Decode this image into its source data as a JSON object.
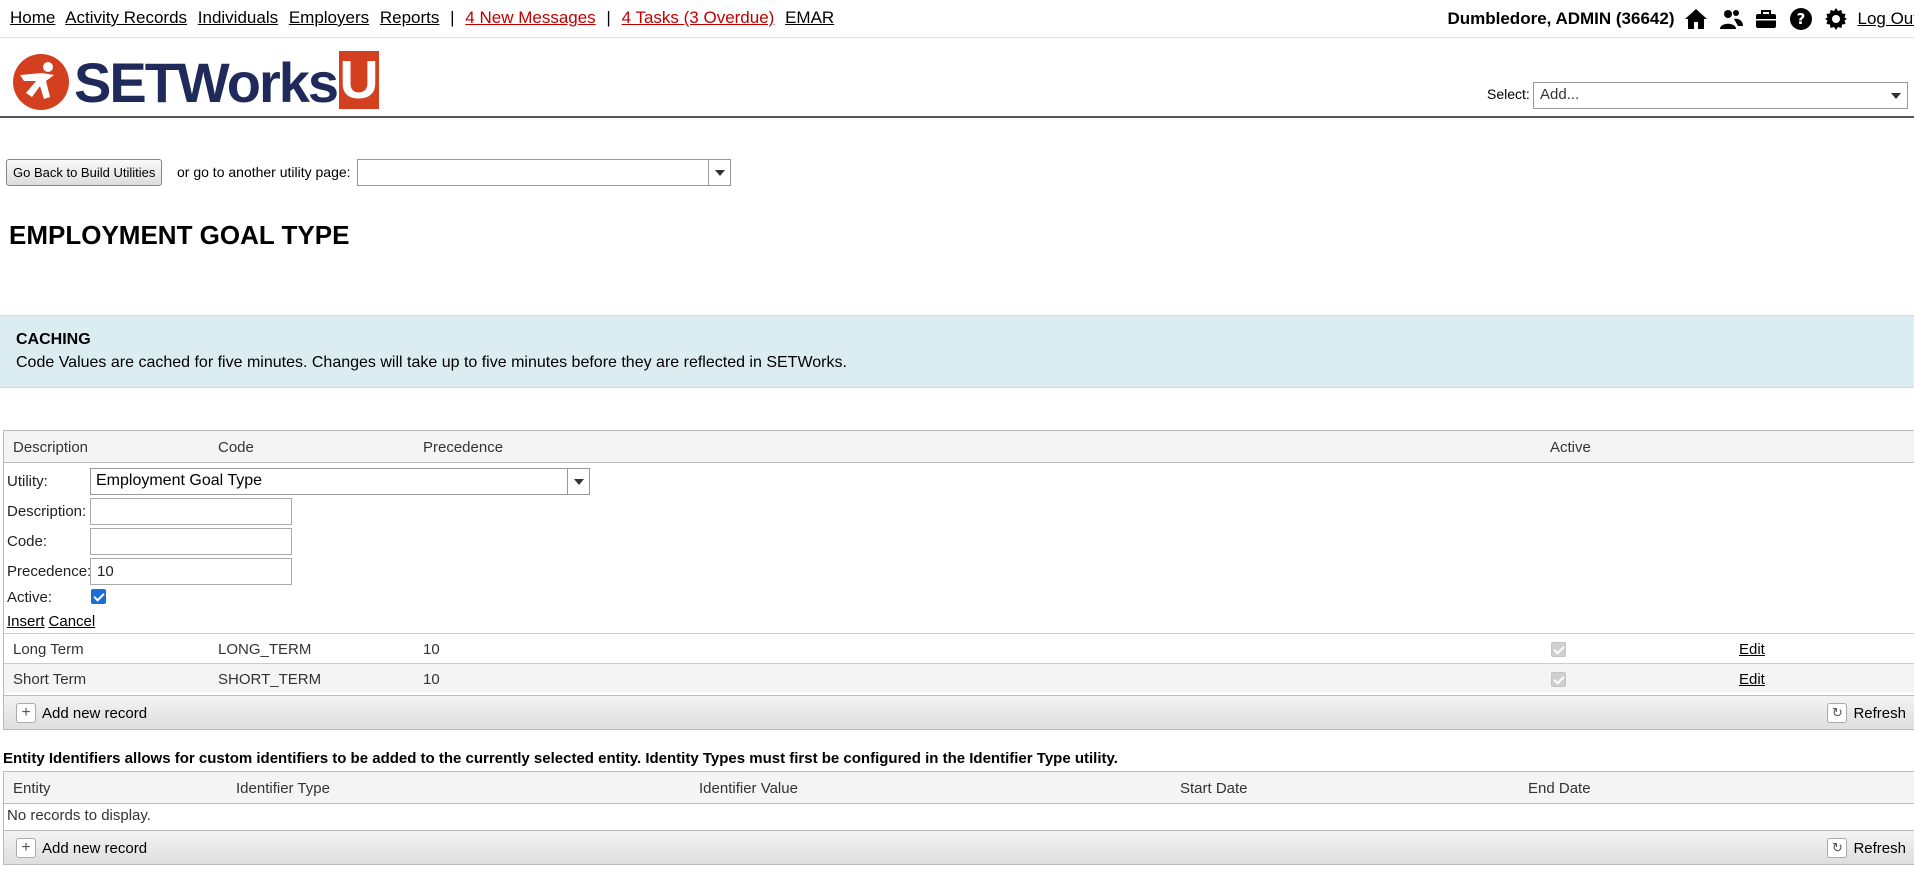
{
  "nav": {
    "links": [
      "Home",
      "Activity Records",
      "Individuals",
      "Employers",
      "Reports"
    ],
    "separator": "|",
    "messages": "4 New Messages",
    "tasks": "4 Tasks (3 Overdue)",
    "emar": "EMAR",
    "alert_color": "#c00000"
  },
  "user": {
    "name": "Dumbledore, ADMIN  (36642)",
    "icons": [
      "home-icon",
      "people-icon",
      "briefcase-icon",
      "help-icon",
      "settings-icon"
    ],
    "logout": "Log Out"
  },
  "header": {
    "logo_text": "SETWorks",
    "logo_u": "U",
    "brand_color": "#1f2a5a",
    "accent_color": "#d2401f",
    "select_label": "Select:",
    "select_value": "Add..."
  },
  "utility_bar": {
    "back_button": "Go Back to Build Utilities",
    "goto_label": "or go to another utility page:",
    "goto_value": ""
  },
  "page": {
    "title": "EMPLOYMENT GOAL TYPE"
  },
  "caching": {
    "title": "CACHING",
    "text": "Code Values are cached for five minutes. Changes will take up to five minutes before they are reflected in SETWorks.",
    "bg_color": "#dcedf1"
  },
  "grid1": {
    "columns": [
      "Description",
      "Code",
      "Precedence",
      "Active"
    ],
    "form": {
      "utility_label": "Utility:",
      "utility_value": "Employment Goal Type",
      "description_label": "Description:",
      "description_value": "",
      "code_label": "Code:",
      "code_value": "",
      "precedence_label": "Precedence:",
      "precedence_value": "10",
      "active_label": "Active:",
      "active_checked": true,
      "insert": "Insert",
      "cancel": "Cancel"
    },
    "rows": [
      {
        "description": "Long Term",
        "code": "LONG_TERM",
        "precedence": "10",
        "active": true,
        "action": "Edit"
      },
      {
        "description": "Short Term",
        "code": "SHORT_TERM",
        "precedence": "10",
        "active": true,
        "action": "Edit"
      }
    ],
    "add_label": "Add new record",
    "refresh_label": "Refresh"
  },
  "entity_note": "Entity Identifiers allows for custom identifiers to be added to the currently selected entity. Identity Types must first be configured in the Identifier Type utility.",
  "grid2": {
    "columns": [
      "Entity",
      "Identifier Type",
      "Identifier Value",
      "Start Date",
      "End Date"
    ],
    "empty_text": "No records to display.",
    "add_label": "Add new record",
    "refresh_label": "Refresh"
  }
}
